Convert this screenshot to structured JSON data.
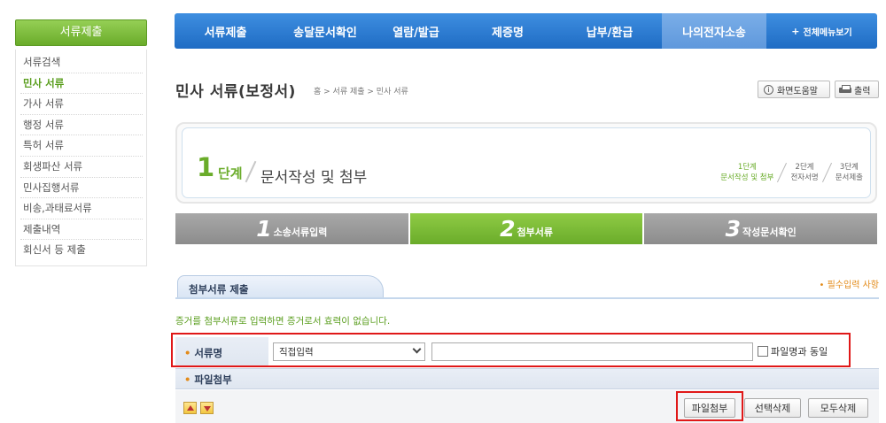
{
  "sidebar": {
    "header": "서류제출",
    "items": [
      {
        "label": "서류검색",
        "active": false
      },
      {
        "label": "민사 서류",
        "active": true
      },
      {
        "label": "가사 서류",
        "active": false
      },
      {
        "label": "행정 서류",
        "active": false
      },
      {
        "label": "특허 서류",
        "active": false
      },
      {
        "label": "회생파산 서류",
        "active": false
      },
      {
        "label": "민사집행서류",
        "active": false
      },
      {
        "label": "비송,과태료서류",
        "active": false
      },
      {
        "label": "제출내역",
        "active": false
      },
      {
        "label": "회신서 등 제출",
        "active": false
      }
    ]
  },
  "topnav": {
    "items": [
      {
        "label": "서류제출",
        "active": false
      },
      {
        "label": "송달문서확인",
        "active": false
      },
      {
        "label": "열람/발급",
        "active": false
      },
      {
        "label": "제증명",
        "active": false
      },
      {
        "label": "납부/환급",
        "active": false
      },
      {
        "label": "나의전자소송",
        "active": true
      }
    ],
    "all_menu": "전체메뉴보기",
    "all_menu_icon": "plus-icon"
  },
  "title": {
    "text": "민사 서류(보정서)",
    "breadcrumb": "홈 > 서류 제출 > 민사 서류"
  },
  "buttons": {
    "help": "화면도움말",
    "help_icon": "info-icon",
    "print": "출력",
    "print_icon": "printer-icon"
  },
  "stepbox": {
    "number": "1",
    "unit": "단계",
    "name": "문서작성 및 첨부",
    "mini": [
      {
        "line1": "1단계",
        "line2": "문서작성 및 첨부",
        "active": true
      },
      {
        "line1": "2단계",
        "line2": "전자서명",
        "active": false
      },
      {
        "line1": "3단계",
        "line2": "문서제출",
        "active": false
      }
    ]
  },
  "substeps": [
    {
      "num": "1",
      "label": "소송서류입력",
      "active": false
    },
    {
      "num": "2",
      "label": "첨부서류",
      "active": true
    },
    {
      "num": "3",
      "label": "작성문서확인",
      "active": false
    }
  ],
  "section": {
    "tab": "첨부서류 제출",
    "required_note": "• 필수입력 사항",
    "notice": "증거를 첨부서류로 입력하면 증거로서 효력이 없습니다."
  },
  "form": {
    "doc_name_label": "서류명",
    "select_value": "직접입력",
    "text_value": "",
    "checkbox_label": "파일명과 동일",
    "file_attach_label": "파일첨부"
  },
  "actions": {
    "attach": "파일첨부",
    "delete_selected": "선택삭제",
    "delete_all": "모두삭제"
  },
  "colors": {
    "brand_green": "#6aac2a",
    "nav_blue": "#1f6cc4",
    "accent_orange": "#e38b1a",
    "highlight_red": "#e01818"
  }
}
